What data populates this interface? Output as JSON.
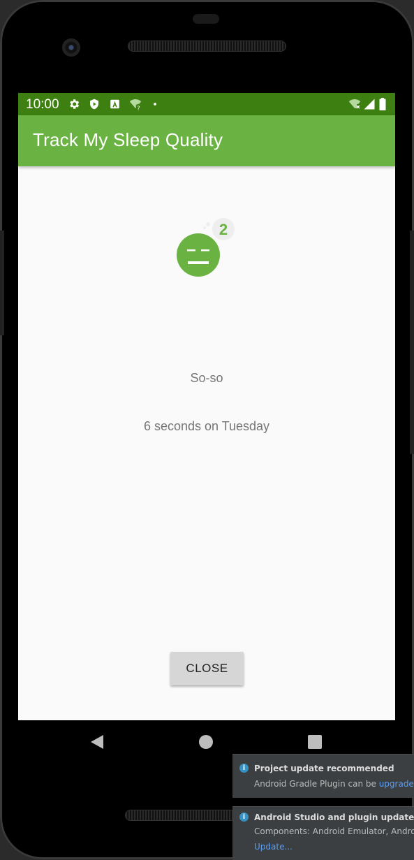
{
  "status_bar": {
    "time": "10:00",
    "icons": [
      "gear-icon",
      "shield-icon",
      "a-icon",
      "wifi-question-icon",
      "dot-icon",
      "wifi-x-icon",
      "signal-icon",
      "battery-icon"
    ],
    "color": "#3d7f10"
  },
  "app_bar": {
    "title": "Track My Sleep Quality",
    "color": "#6ab343"
  },
  "detail": {
    "quality_icon": "sleep-quality-2-icon",
    "quality_number": "2",
    "quality_string": "So-so",
    "sleep_length": "6 seconds on Tuesday",
    "close_label": "CLOSE"
  },
  "nav_bar": {
    "icons": [
      "back-icon",
      "home-icon",
      "recents-icon"
    ]
  },
  "notifications": [
    {
      "title": "Project update recommended",
      "body_prefix": "Android Gradle Plugin can be ",
      "link": "upgraded",
      "body_suffix": "."
    },
    {
      "title": "Android Studio and plugin updates availab",
      "body": "Components: Android Emulator, Android SI",
      "link": "Update..."
    }
  ]
}
